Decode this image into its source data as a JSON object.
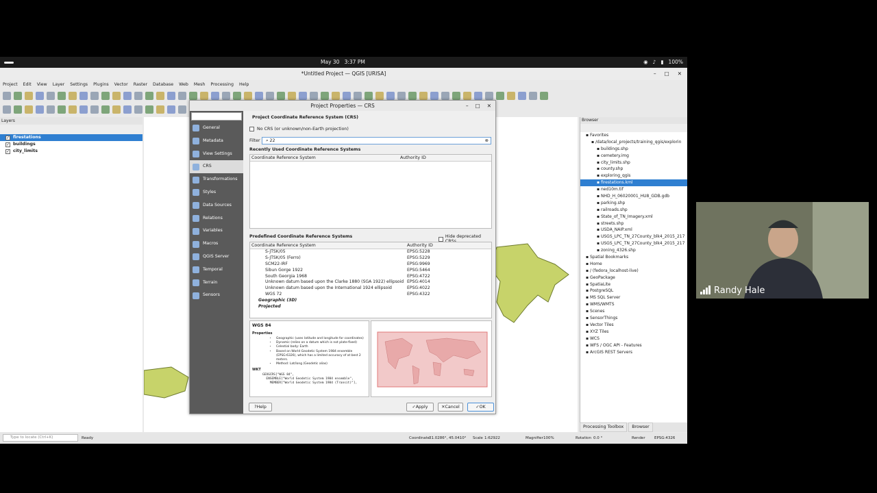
{
  "system_bar": {
    "date": "May 30",
    "time": "3:37 PM",
    "battery": "100%"
  },
  "window": {
    "title": "*Untitled Project — QGIS [URISA]"
  },
  "menu": [
    "Project",
    "Edit",
    "View",
    "Layer",
    "Settings",
    "Plugins",
    "Vector",
    "Raster",
    "Database",
    "Web",
    "Mesh",
    "Processing",
    "Help"
  ],
  "layers_panel": {
    "title": "Layers",
    "items": [
      {
        "label": "firestations",
        "checked": true,
        "selected": true
      },
      {
        "label": "buildings",
        "checked": true,
        "selected": false
      },
      {
        "label": "city_limits",
        "checked": true,
        "selected": false
      }
    ]
  },
  "browser_panel": {
    "title": "Browser",
    "items": [
      {
        "label": "Favorites",
        "indent": 1
      },
      {
        "label": "/data/local_projects/training_qgis/explorin",
        "indent": 2
      },
      {
        "label": "buildings.shp",
        "indent": 3
      },
      {
        "label": "cemetery.img",
        "indent": 3
      },
      {
        "label": "city_limits.shp",
        "indent": 3
      },
      {
        "label": "county.shp",
        "indent": 3
      },
      {
        "label": "exploring_qgis",
        "indent": 3
      },
      {
        "label": "firestations.kml",
        "indent": 3,
        "selected": true
      },
      {
        "label": "ned10m.tif",
        "indent": 3
      },
      {
        "label": "NHD_H_06020001_HU8_GDB.gdb",
        "indent": 3
      },
      {
        "label": "parking.shp",
        "indent": 3
      },
      {
        "label": "railroads.shp",
        "indent": 3
      },
      {
        "label": "State_of_TN_Imagery.xml",
        "indent": 3
      },
      {
        "label": "streets.shp",
        "indent": 3
      },
      {
        "label": "USDA_NAIP.xml",
        "indent": 3
      },
      {
        "label": "USGS_LPC_TN_27County_blk4_2015_217",
        "indent": 3
      },
      {
        "label": "USGS_LPC_TN_27County_blk4_2015_217",
        "indent": 3
      },
      {
        "label": "zoning_4326.shp",
        "indent": 3
      },
      {
        "label": "Spatial Bookmarks",
        "indent": 1
      },
      {
        "label": "Home",
        "indent": 1
      },
      {
        "label": "/ (fedora_localhost-live)",
        "indent": 1
      },
      {
        "label": "GeoPackage",
        "indent": 1
      },
      {
        "label": "SpatiaLite",
        "indent": 1
      },
      {
        "label": "PostgreSQL",
        "indent": 1
      },
      {
        "label": "MS SQL Server",
        "indent": 1
      },
      {
        "label": "WMS/WMTS",
        "indent": 1
      },
      {
        "label": "Scenes",
        "indent": 1
      },
      {
        "label": "SensorThings",
        "indent": 1
      },
      {
        "label": "Vector Tiles",
        "indent": 1
      },
      {
        "label": "XYZ Tiles",
        "indent": 1
      },
      {
        "label": "WCS",
        "indent": 1
      },
      {
        "label": "WFS / OGC API - Features",
        "indent": 1
      },
      {
        "label": "ArcGIS REST Servers",
        "indent": 1
      }
    ],
    "tabs": [
      "Processing Toolbox",
      "Browser"
    ]
  },
  "status": {
    "locate_placeholder": "Type to locate (Ctrl+K)",
    "ready": "Ready",
    "coordinate_label": "Coordinate",
    "coordinate": "31.0286°, 45.0410°",
    "scale_label": "Scale",
    "scale": "1:62922",
    "magnifier_label": "Magnifier",
    "magnifier": "100%",
    "rotation_label": "Rotation",
    "rotation": "0.0 °",
    "render": "Render",
    "crs": "EPSG:4326"
  },
  "dialog": {
    "title": "Project Properties — CRS",
    "sidebar": [
      "General",
      "Metadata",
      "View Settings",
      "CRS",
      "Transformations",
      "Styles",
      "Data Sources",
      "Relations",
      "Variables",
      "Macros",
      "QGIS Server",
      "Temporal",
      "Terrain",
      "Sensors"
    ],
    "section_title": "Project Coordinate Reference System (CRS)",
    "no_crs": "No CRS (or unknown/non-Earth projection)",
    "filter_label": "Filter",
    "filter_value": "22",
    "recent_title": "Recently Used Coordinate Reference Systems",
    "col_crs": "Coordinate Reference System",
    "col_auth": "Authority ID",
    "predefined_title": "Predefined Coordinate Reference Systems",
    "hide_deprecated": "Hide deprecated CRSs",
    "predefined_rows": [
      {
        "name": "S-JTSK/05",
        "id": "EPSG:5228"
      },
      {
        "name": "S-JTSK/05 (Ferro)",
        "id": "EPSG:5229"
      },
      {
        "name": "SCM22-IRF",
        "id": "EPSG:9969"
      },
      {
        "name": "Sibun Gorge 1922",
        "id": "EPSG:5464"
      },
      {
        "name": "South Georgia 1968",
        "id": "EPSG:4722"
      },
      {
        "name": "Unknown datum based upon the Clarke 1880 (SGA 1922) ellipsoid",
        "id": "EPSG:4014"
      },
      {
        "name": "Unknown datum based upon the International 1924 ellipsoid",
        "id": "EPSG:4022"
      },
      {
        "name": "WGS 72",
        "id": "EPSG:4322"
      },
      {
        "name": "Geographic (3D)",
        "id": ""
      },
      {
        "name": "Projected",
        "id": ""
      }
    ],
    "details": {
      "name": "WGS 84",
      "properties_label": "Properties",
      "bullets": [
        "Geographic (uses latitude and longitude for coordinates)",
        "Dynamic (relies on a datum which is not plate-fixed)",
        "Celestial body: Earth",
        "Based on World Geodetic System 1984 ensemble (EPSG:6326), which has a limited accuracy of at best 2 meters.",
        "Method: Lat/long (Geodetic alias)"
      ],
      "wkt_label": "WKT",
      "wkt": [
        "GEOGCRS[\"WGS 84\",",
        "  ENSEMBLE[\"World Geodetic System 1984 ensemble\",",
        "    MEMBER[\"World Geodetic System 1984 (Transit)\"],"
      ]
    },
    "buttons": {
      "help": "Help",
      "apply": "Apply",
      "cancel": "Cancel",
      "ok": "OK"
    }
  },
  "webcam": {
    "name": "Randy Hale"
  }
}
